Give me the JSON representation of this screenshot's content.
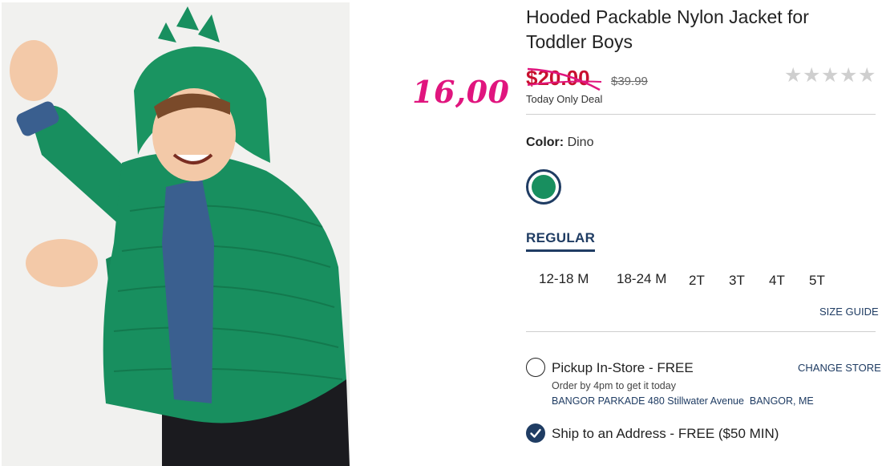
{
  "product": {
    "title_line1": "Hooded Packable Nylon Jacket for",
    "title_line2": "Toddler Boys",
    "sale_price": "$20.00",
    "original_price": "$39.99",
    "deal_note": "Today Only Deal",
    "rating": {
      "filled": 0,
      "total": 5,
      "star_glyph": "★",
      "star_color": "#cfcfcf"
    },
    "image_icon": "toddler-dino-jacket-photo"
  },
  "annotation": {
    "handwritten_price": "16,00",
    "color": "#e0157e"
  },
  "color": {
    "label": "Color:",
    "value": "Dino",
    "swatch_hex": "#188f5f"
  },
  "fit": {
    "tab_label": "REGULAR"
  },
  "sizes": [
    "12-18 M",
    "18-24 M",
    "2T",
    "3T",
    "4T",
    "5T"
  ],
  "size_guide": "SIZE GUIDE",
  "fulfillment": {
    "pickup_label": "Pickup In-Store - FREE",
    "change_store": "CHANGE STORE",
    "order_note": "Order by 4pm to get it today",
    "store_address": "BANGOR PARKADE 480 Stillwater Avenue  BANGOR, ME",
    "ship_label": "Ship to an Address - FREE ($50 MIN)",
    "ship_selected": true
  },
  "colors": {
    "brand_navy": "#1f3c63",
    "sale_red": "#c8102e",
    "jacket_green": "#188f5f"
  }
}
